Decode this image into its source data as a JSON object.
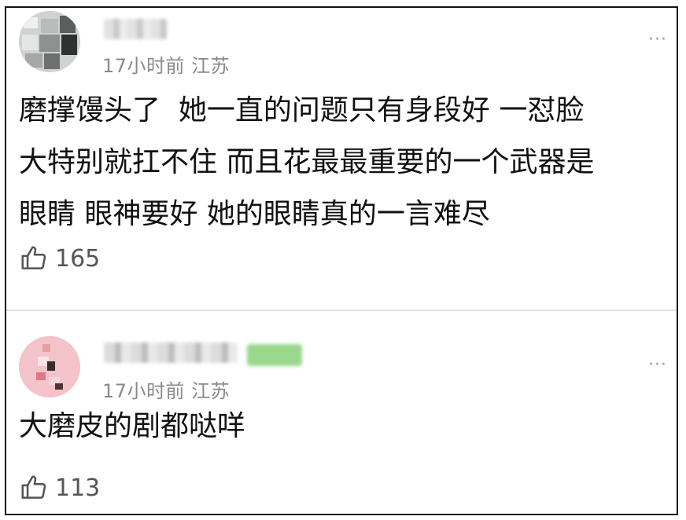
{
  "comments": [
    {
      "time": "17小时前",
      "location": "江苏",
      "text": "磨撑馒头了  她一直的问题只有身段好 一怼脸\n大特别就扛不住 而且花最最重要的一个武器是\n眼睛 眼神要好 她的眼睛真的一言难尽",
      "likes": "165",
      "more_icon": "···"
    },
    {
      "time": "17小时前",
      "location": "江苏",
      "text": "大磨皮的剧都哒咩",
      "likes": "113",
      "more_icon": "···"
    }
  ],
  "icons": {
    "like": "thumbs-up-icon",
    "more": "more-dots-icon"
  },
  "colors": {
    "meta": "#8a8a8a",
    "text": "#111111",
    "badge": "#9ad88e"
  }
}
